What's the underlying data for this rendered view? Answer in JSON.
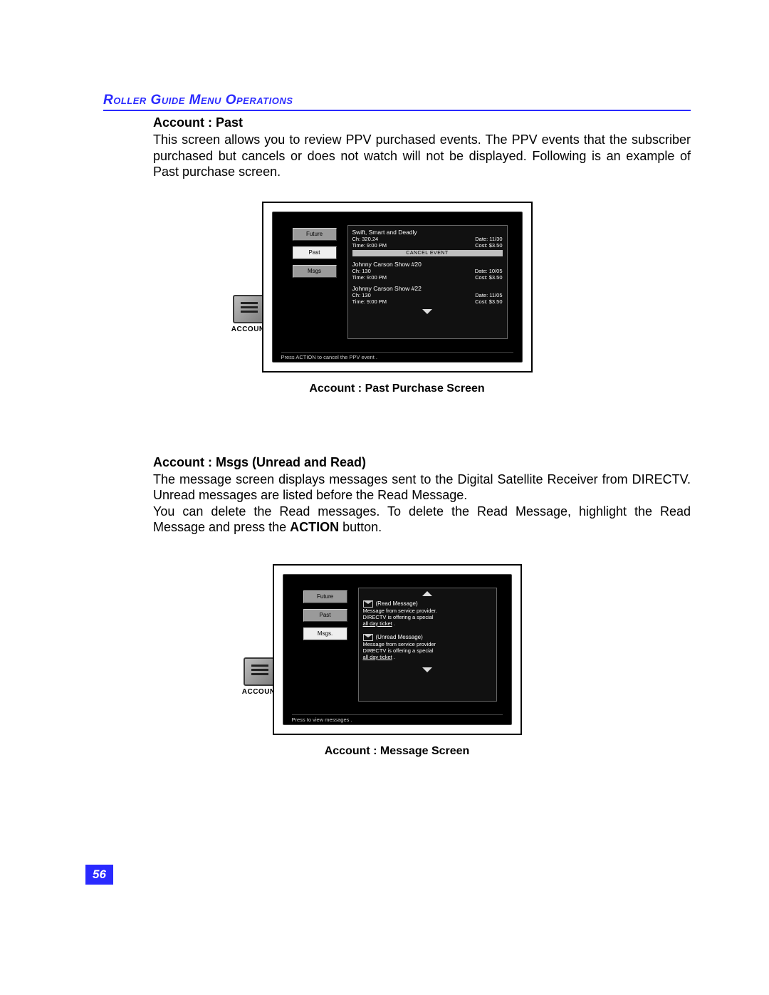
{
  "header": "Roller Guide Menu Operations",
  "pageNumber": "56",
  "sec1": {
    "title": "Account : Past",
    "body": "This screen allows you to review PPV purchased events. The PPV events that the subscriber purchased but cancels or does not watch will not be displayed. Following is an example of Past purchase screen.",
    "caption": "Account : Past Purchase Screen"
  },
  "sec2": {
    "title": "Account : Msgs (Unread and Read)",
    "body1": "The message screen displays messages sent to the Digital Satellite Receiver from DIRECTV. Unread messages are listed before the Read Message.",
    "body2_a": "You can delete the Read messages. To delete the Read Message, highlight the Read Message and press the ",
    "body2_bold": "ACTION",
    "body2_b": " button.",
    "caption": "Account : Message Screen"
  },
  "accountLabel": "ACCOUNT",
  "fig1": {
    "sideButtons": [
      "Future",
      "Past",
      "Msgs"
    ],
    "selectedIndex": 1,
    "cancelLabel": "CANCEL EVENT",
    "hint": "Press  ACTION to cancel the PPV event    .",
    "events": [
      {
        "title": "Swift, Smart and Deadly",
        "ch": "Ch: 320.24",
        "date": "Date:  11/30",
        "time": "Time: 9:00 PM",
        "cost": "Cost:   $3.50"
      },
      {
        "title": "Johnny Carson Show #20",
        "ch": "Ch: 130",
        "date": "Date:  10/05",
        "time": "Time: 9:00 PM",
        "cost": "Cost:   $3.50"
      },
      {
        "title": "Johnny Carson Show #22",
        "ch": "Ch: 130",
        "date": "Date:  11/05",
        "time": "Time: 9:00 PM",
        "cost": "Cost:   $3.50"
      }
    ]
  },
  "fig2": {
    "sideButtons": [
      "Future",
      "Past",
      "Msgs."
    ],
    "selectedIndex": 2,
    "hint": "Press       to view messages   .",
    "messages": [
      {
        "status": "(Read Message)",
        "l1": "Message from service provider.",
        "l2a": "DIRECTV is offering a special",
        "l2u": "all day ticket",
        "l2b": "  ."
      },
      {
        "status": "(Unread Message)",
        "l1": "Message from service provider",
        "l2a": "DIRECTV  is offering a special",
        "l2u": "all day ticket",
        "l2b": "  ."
      }
    ]
  }
}
